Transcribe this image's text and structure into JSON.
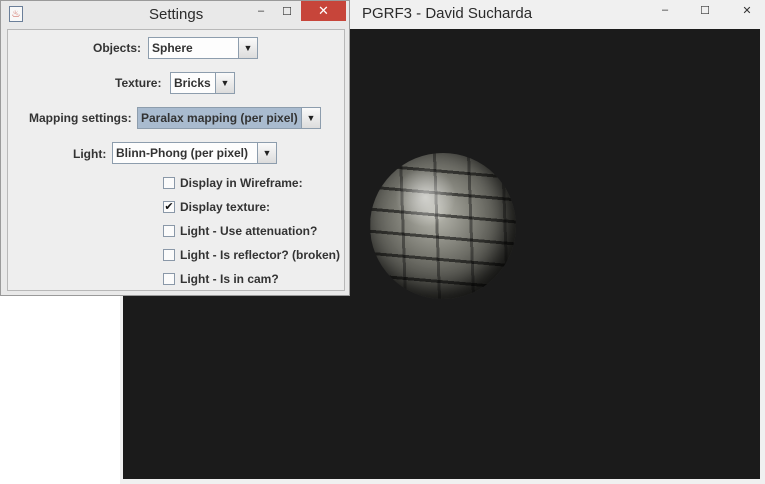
{
  "main_window": {
    "title": "PGRF3 - David Sucharda",
    "minimize_symbol": "–",
    "maximize_symbol": "☐",
    "close_symbol": "✕"
  },
  "settings_window": {
    "title": "Settings",
    "minimize_symbol": "–",
    "maximize_symbol": "☐",
    "close_symbol": "✕",
    "objects": {
      "label": "Objects:",
      "value": "Sphere"
    },
    "texture": {
      "label": "Texture:",
      "value": "Bricks"
    },
    "mapping": {
      "label": "Mapping settings:",
      "value": "Paralax mapping (per pixel)"
    },
    "light": {
      "label": "Light:",
      "value": "Blinn-Phong (per pixel)"
    },
    "checkboxes": [
      {
        "label": "Display in Wireframe:",
        "checked": false,
        "mark": ""
      },
      {
        "label": "Display texture:",
        "checked": true,
        "mark": "✔"
      },
      {
        "label": "Light - Use attenuation?",
        "checked": false,
        "mark": ""
      },
      {
        "label": "Light - Is reflector? (broken)",
        "checked": false,
        "mark": ""
      },
      {
        "label": "Light - Is in cam?",
        "checked": false,
        "mark": ""
      }
    ],
    "dropdown_arrow": "▼"
  }
}
